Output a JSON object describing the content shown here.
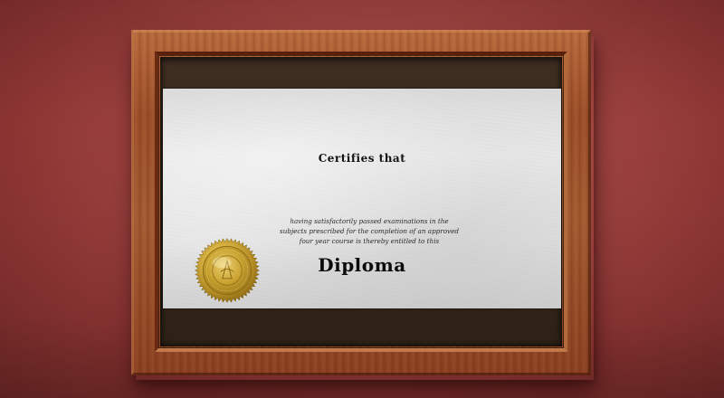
{
  "certificate": {
    "heading": "Certifies that",
    "body_lines": [
      "having satisfactorily passed examinations in the",
      "subjects prescribed for the completion of an approved",
      "four year course is thereby entitled to this"
    ],
    "title": "Diploma"
  },
  "seal": {
    "icon": "gold-seal-icon",
    "color": "#c9a227"
  },
  "colors": {
    "wall": "#a44845",
    "frame_wood": "#9c4f28",
    "mat": "#33261c",
    "paper": "#e7e7e7"
  }
}
